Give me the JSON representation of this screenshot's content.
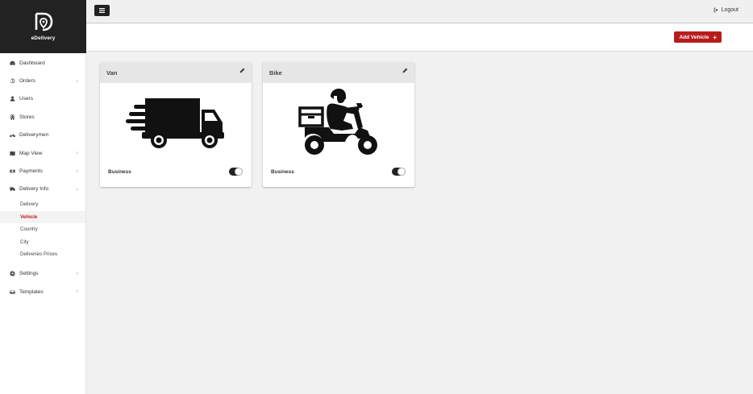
{
  "brand": {
    "name": "eDelivery"
  },
  "sidebar": {
    "items": [
      {
        "label": "Dashboard",
        "icon": "dashboard-icon",
        "expandable": false
      },
      {
        "label": "Orders",
        "icon": "history-icon",
        "expandable": true
      },
      {
        "label": "Users",
        "icon": "user-icon",
        "expandable": false
      },
      {
        "label": "Stores",
        "icon": "building-icon",
        "expandable": false
      },
      {
        "label": "Deliverymen",
        "icon": "motorcycle-icon",
        "expandable": false
      },
      {
        "label": "Map View",
        "icon": "map-icon",
        "expandable": true
      },
      {
        "label": "Payments",
        "icon": "money-icon",
        "expandable": true
      },
      {
        "label": "Delivery Info",
        "icon": "truck-icon",
        "expandable": true
      }
    ],
    "delivery_info_sub": [
      {
        "label": "Delivery",
        "active": false
      },
      {
        "label": "Vehicle",
        "active": true
      },
      {
        "label": "Country",
        "active": false
      },
      {
        "label": "City",
        "active": false
      },
      {
        "label": "Deliveries Prices",
        "active": false
      }
    ],
    "bottom_items": [
      {
        "label": "Settings",
        "icon": "gear-icon",
        "expandable": true
      },
      {
        "label": "Templates",
        "icon": "envelope-icon",
        "expandable": true
      }
    ]
  },
  "topbar": {
    "logout_label": "Logout"
  },
  "toolbar": {
    "add_vehicle_label": "Add Vehicle",
    "add_icon": "+"
  },
  "vehicles": [
    {
      "name": "Van",
      "category": "Business",
      "enabled": true,
      "image": "van-image"
    },
    {
      "name": "Bike",
      "category": "Business",
      "enabled": true,
      "image": "scooter-image"
    }
  ],
  "colors": {
    "accent": "#b71c1c",
    "dark": "#222222"
  },
  "chevron": "‹"
}
